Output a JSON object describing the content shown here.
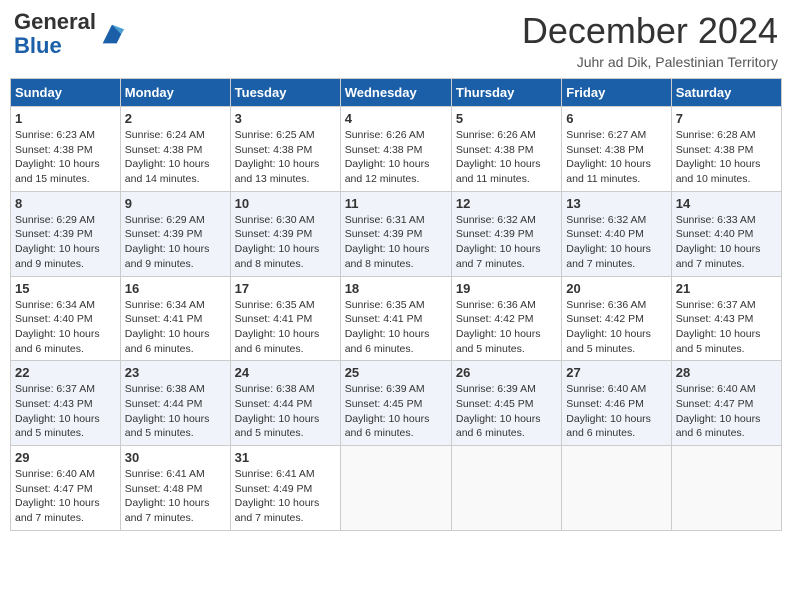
{
  "header": {
    "logo_line1": "General",
    "logo_line2": "Blue",
    "month_title": "December 2024",
    "subtitle": "Juhr ad Dik, Palestinian Territory"
  },
  "weekdays": [
    "Sunday",
    "Monday",
    "Tuesday",
    "Wednesday",
    "Thursday",
    "Friday",
    "Saturday"
  ],
  "weeks": [
    [
      {
        "day": "1",
        "info": "Sunrise: 6:23 AM\nSunset: 4:38 PM\nDaylight: 10 hours and 15 minutes."
      },
      {
        "day": "2",
        "info": "Sunrise: 6:24 AM\nSunset: 4:38 PM\nDaylight: 10 hours and 14 minutes."
      },
      {
        "day": "3",
        "info": "Sunrise: 6:25 AM\nSunset: 4:38 PM\nDaylight: 10 hours and 13 minutes."
      },
      {
        "day": "4",
        "info": "Sunrise: 6:26 AM\nSunset: 4:38 PM\nDaylight: 10 hours and 12 minutes."
      },
      {
        "day": "5",
        "info": "Sunrise: 6:26 AM\nSunset: 4:38 PM\nDaylight: 10 hours and 11 minutes."
      },
      {
        "day": "6",
        "info": "Sunrise: 6:27 AM\nSunset: 4:38 PM\nDaylight: 10 hours and 11 minutes."
      },
      {
        "day": "7",
        "info": "Sunrise: 6:28 AM\nSunset: 4:38 PM\nDaylight: 10 hours and 10 minutes."
      }
    ],
    [
      {
        "day": "8",
        "info": "Sunrise: 6:29 AM\nSunset: 4:39 PM\nDaylight: 10 hours and 9 minutes."
      },
      {
        "day": "9",
        "info": "Sunrise: 6:29 AM\nSunset: 4:39 PM\nDaylight: 10 hours and 9 minutes."
      },
      {
        "day": "10",
        "info": "Sunrise: 6:30 AM\nSunset: 4:39 PM\nDaylight: 10 hours and 8 minutes."
      },
      {
        "day": "11",
        "info": "Sunrise: 6:31 AM\nSunset: 4:39 PM\nDaylight: 10 hours and 8 minutes."
      },
      {
        "day": "12",
        "info": "Sunrise: 6:32 AM\nSunset: 4:39 PM\nDaylight: 10 hours and 7 minutes."
      },
      {
        "day": "13",
        "info": "Sunrise: 6:32 AM\nSunset: 4:40 PM\nDaylight: 10 hours and 7 minutes."
      },
      {
        "day": "14",
        "info": "Sunrise: 6:33 AM\nSunset: 4:40 PM\nDaylight: 10 hours and 7 minutes."
      }
    ],
    [
      {
        "day": "15",
        "info": "Sunrise: 6:34 AM\nSunset: 4:40 PM\nDaylight: 10 hours and 6 minutes."
      },
      {
        "day": "16",
        "info": "Sunrise: 6:34 AM\nSunset: 4:41 PM\nDaylight: 10 hours and 6 minutes."
      },
      {
        "day": "17",
        "info": "Sunrise: 6:35 AM\nSunset: 4:41 PM\nDaylight: 10 hours and 6 minutes."
      },
      {
        "day": "18",
        "info": "Sunrise: 6:35 AM\nSunset: 4:41 PM\nDaylight: 10 hours and 6 minutes."
      },
      {
        "day": "19",
        "info": "Sunrise: 6:36 AM\nSunset: 4:42 PM\nDaylight: 10 hours and 5 minutes."
      },
      {
        "day": "20",
        "info": "Sunrise: 6:36 AM\nSunset: 4:42 PM\nDaylight: 10 hours and 5 minutes."
      },
      {
        "day": "21",
        "info": "Sunrise: 6:37 AM\nSunset: 4:43 PM\nDaylight: 10 hours and 5 minutes."
      }
    ],
    [
      {
        "day": "22",
        "info": "Sunrise: 6:37 AM\nSunset: 4:43 PM\nDaylight: 10 hours and 5 minutes."
      },
      {
        "day": "23",
        "info": "Sunrise: 6:38 AM\nSunset: 4:44 PM\nDaylight: 10 hours and 5 minutes."
      },
      {
        "day": "24",
        "info": "Sunrise: 6:38 AM\nSunset: 4:44 PM\nDaylight: 10 hours and 5 minutes."
      },
      {
        "day": "25",
        "info": "Sunrise: 6:39 AM\nSunset: 4:45 PM\nDaylight: 10 hours and 6 minutes."
      },
      {
        "day": "26",
        "info": "Sunrise: 6:39 AM\nSunset: 4:45 PM\nDaylight: 10 hours and 6 minutes."
      },
      {
        "day": "27",
        "info": "Sunrise: 6:40 AM\nSunset: 4:46 PM\nDaylight: 10 hours and 6 minutes."
      },
      {
        "day": "28",
        "info": "Sunrise: 6:40 AM\nSunset: 4:47 PM\nDaylight: 10 hours and 6 minutes."
      }
    ],
    [
      {
        "day": "29",
        "info": "Sunrise: 6:40 AM\nSunset: 4:47 PM\nDaylight: 10 hours and 7 minutes."
      },
      {
        "day": "30",
        "info": "Sunrise: 6:41 AM\nSunset: 4:48 PM\nDaylight: 10 hours and 7 minutes."
      },
      {
        "day": "31",
        "info": "Sunrise: 6:41 AM\nSunset: 4:49 PM\nDaylight: 10 hours and 7 minutes."
      },
      {
        "day": "",
        "info": ""
      },
      {
        "day": "",
        "info": ""
      },
      {
        "day": "",
        "info": ""
      },
      {
        "day": "",
        "info": ""
      }
    ]
  ]
}
